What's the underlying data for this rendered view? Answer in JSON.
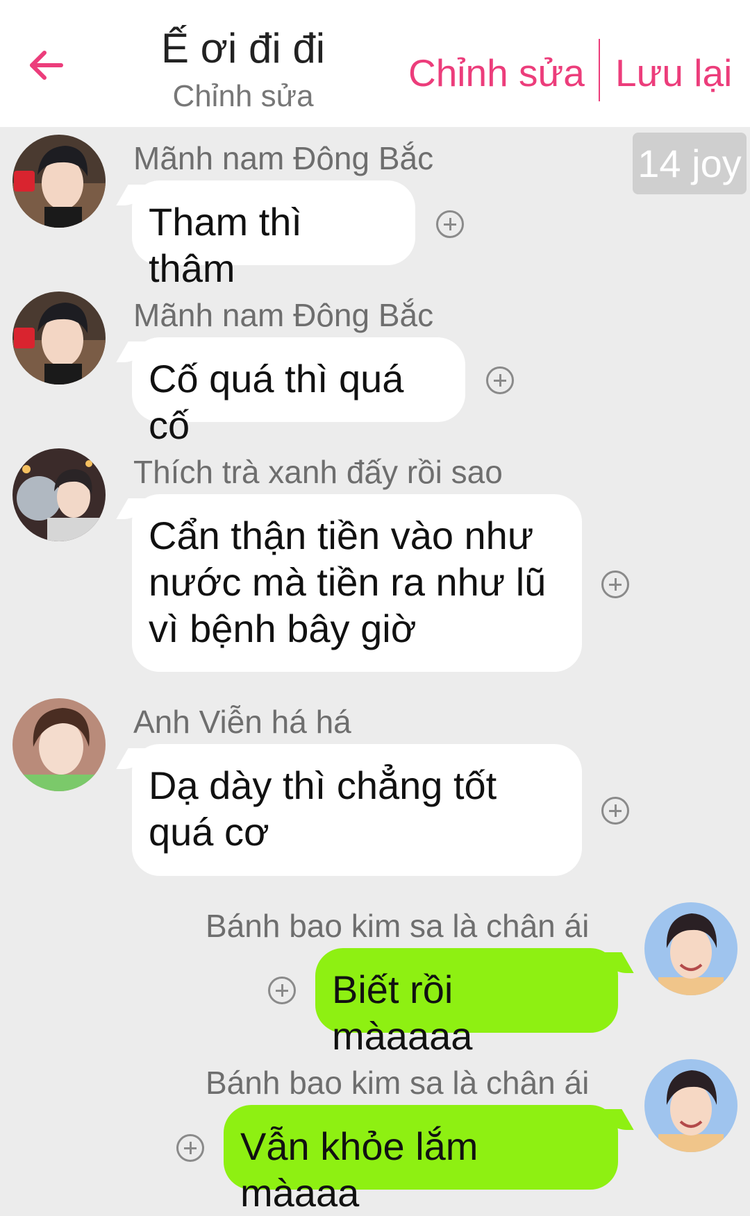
{
  "header": {
    "title": "Ế ơi đi đi",
    "subtitle": "Chỉnh sửa",
    "edit_label": "Chỉnh sửa",
    "save_label": "Lưu lại",
    "back_icon": "arrow-left-icon",
    "accent_color": "#ec3d7b"
  },
  "joy_badge": "14 joy",
  "messages": [
    {
      "sender": "Mãnh nam Đông Bắc",
      "text": "Tham thì thâm",
      "side": "left",
      "avatar": "avatar-male-black-hair"
    },
    {
      "sender": "Mãnh nam Đông Bắc",
      "text": "Cố quá thì quá cố",
      "side": "left",
      "avatar": "avatar-male-black-hair"
    },
    {
      "sender": "Thích trà xanh đấy rồi sao",
      "text": "Cẩn thận tiền vào như nước mà tiền ra như lũ vì bệnh bây giờ",
      "side": "left",
      "avatar": "avatar-male-bubble"
    },
    {
      "sender": "Anh Viễn há há",
      "text": "Dạ dày thì chẳng tốt quá cơ",
      "side": "left",
      "avatar": "avatar-male-green-shirt"
    },
    {
      "sender": "Bánh bao kim sa là chân ái",
      "text": "Biết rồi màaaaa",
      "side": "right",
      "avatar": "avatar-male-blue-bg"
    },
    {
      "sender": "Bánh bao kim sa là chân ái",
      "text": "Vẫn khỏe lắm màaaa",
      "side": "right",
      "avatar": "avatar-male-blue-bg"
    }
  ],
  "colors": {
    "background": "#ececec",
    "bubble_left": "#ffffff",
    "bubble_right": "#8ef012"
  }
}
